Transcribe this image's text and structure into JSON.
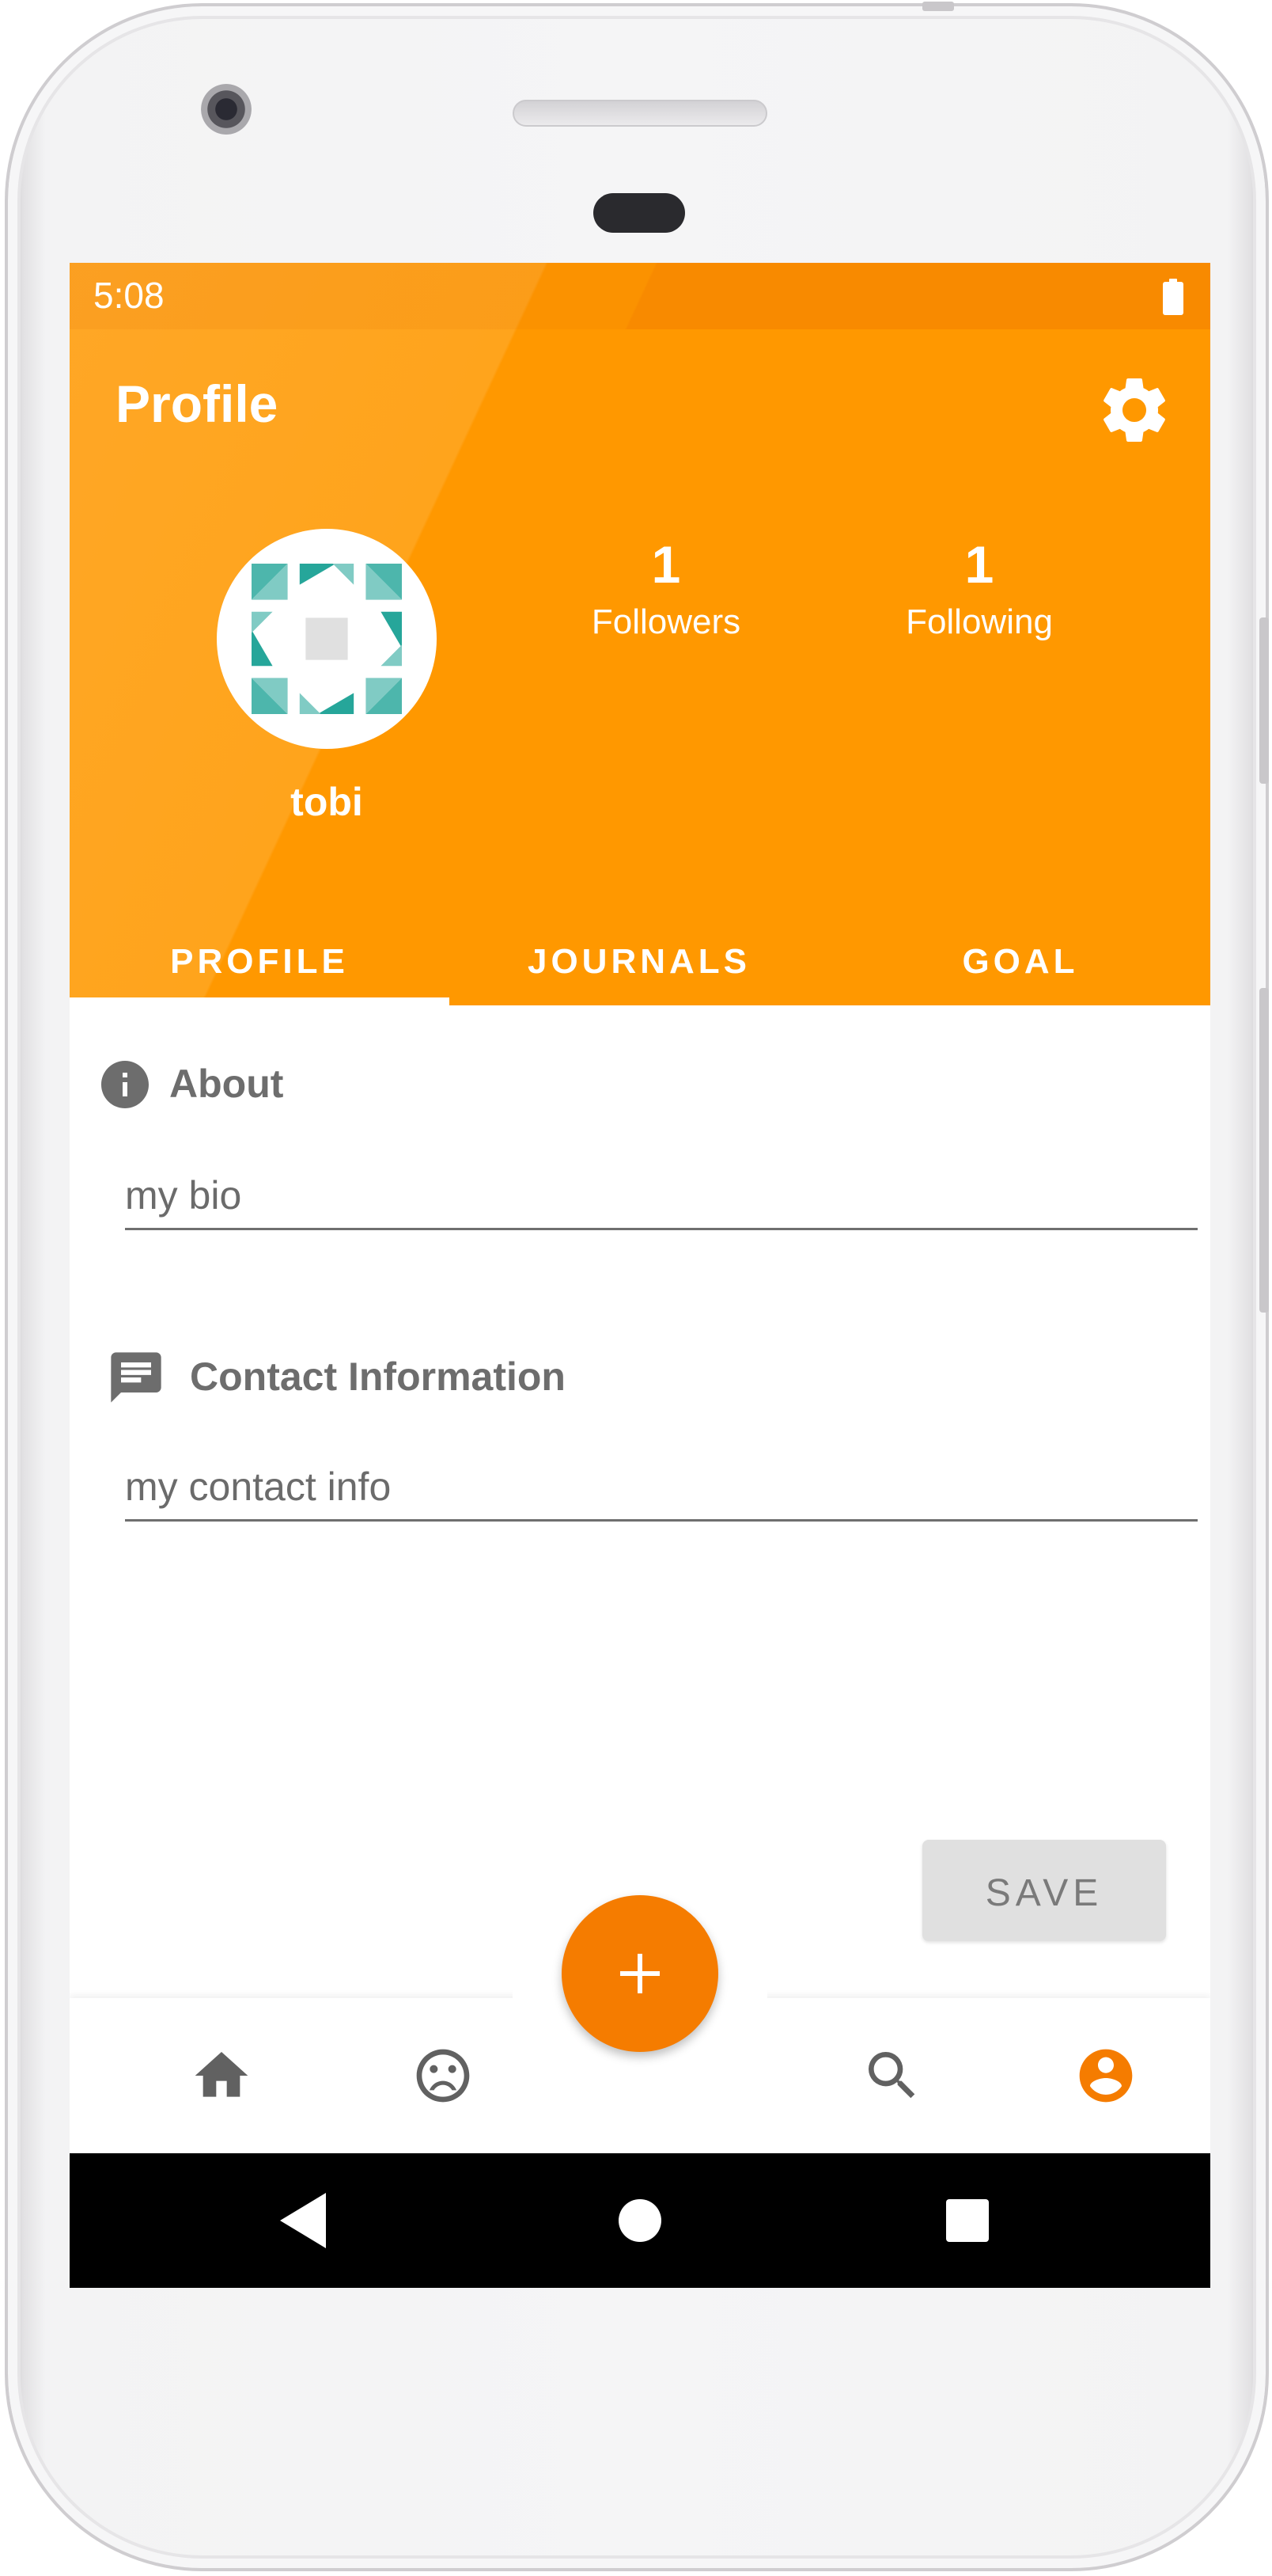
{
  "status_bar": {
    "time": "5:08",
    "battery_icon": "battery-full-icon"
  },
  "header": {
    "title": "Profile",
    "settings_icon": "gear-icon",
    "username": "tobi",
    "followers": {
      "count": "1",
      "label": "Followers"
    },
    "following": {
      "count": "1",
      "label": "Following"
    }
  },
  "tabs": [
    {
      "label": "PROFILE",
      "selected": true
    },
    {
      "label": "JOURNALS",
      "selected": false
    },
    {
      "label": "GOAL",
      "selected": false
    }
  ],
  "about": {
    "title": "About",
    "icon": "info-icon",
    "value": "my bio"
  },
  "contact": {
    "title": "Contact Information",
    "icon": "message-icon",
    "value": "my contact info"
  },
  "save_label": "SAVE",
  "bottom_nav": {
    "items": [
      "home-icon",
      "sad-face-icon",
      "add-icon",
      "search-icon",
      "account-icon"
    ],
    "active": "account-icon"
  },
  "colors": {
    "primary": "#ff9800",
    "primary_light": "#ffa726",
    "accent": "#f57c00",
    "avatar_teal": "#4db6ac",
    "avatar_teal_dark": "#26a69a",
    "text_gray": "#6d6d6d"
  }
}
